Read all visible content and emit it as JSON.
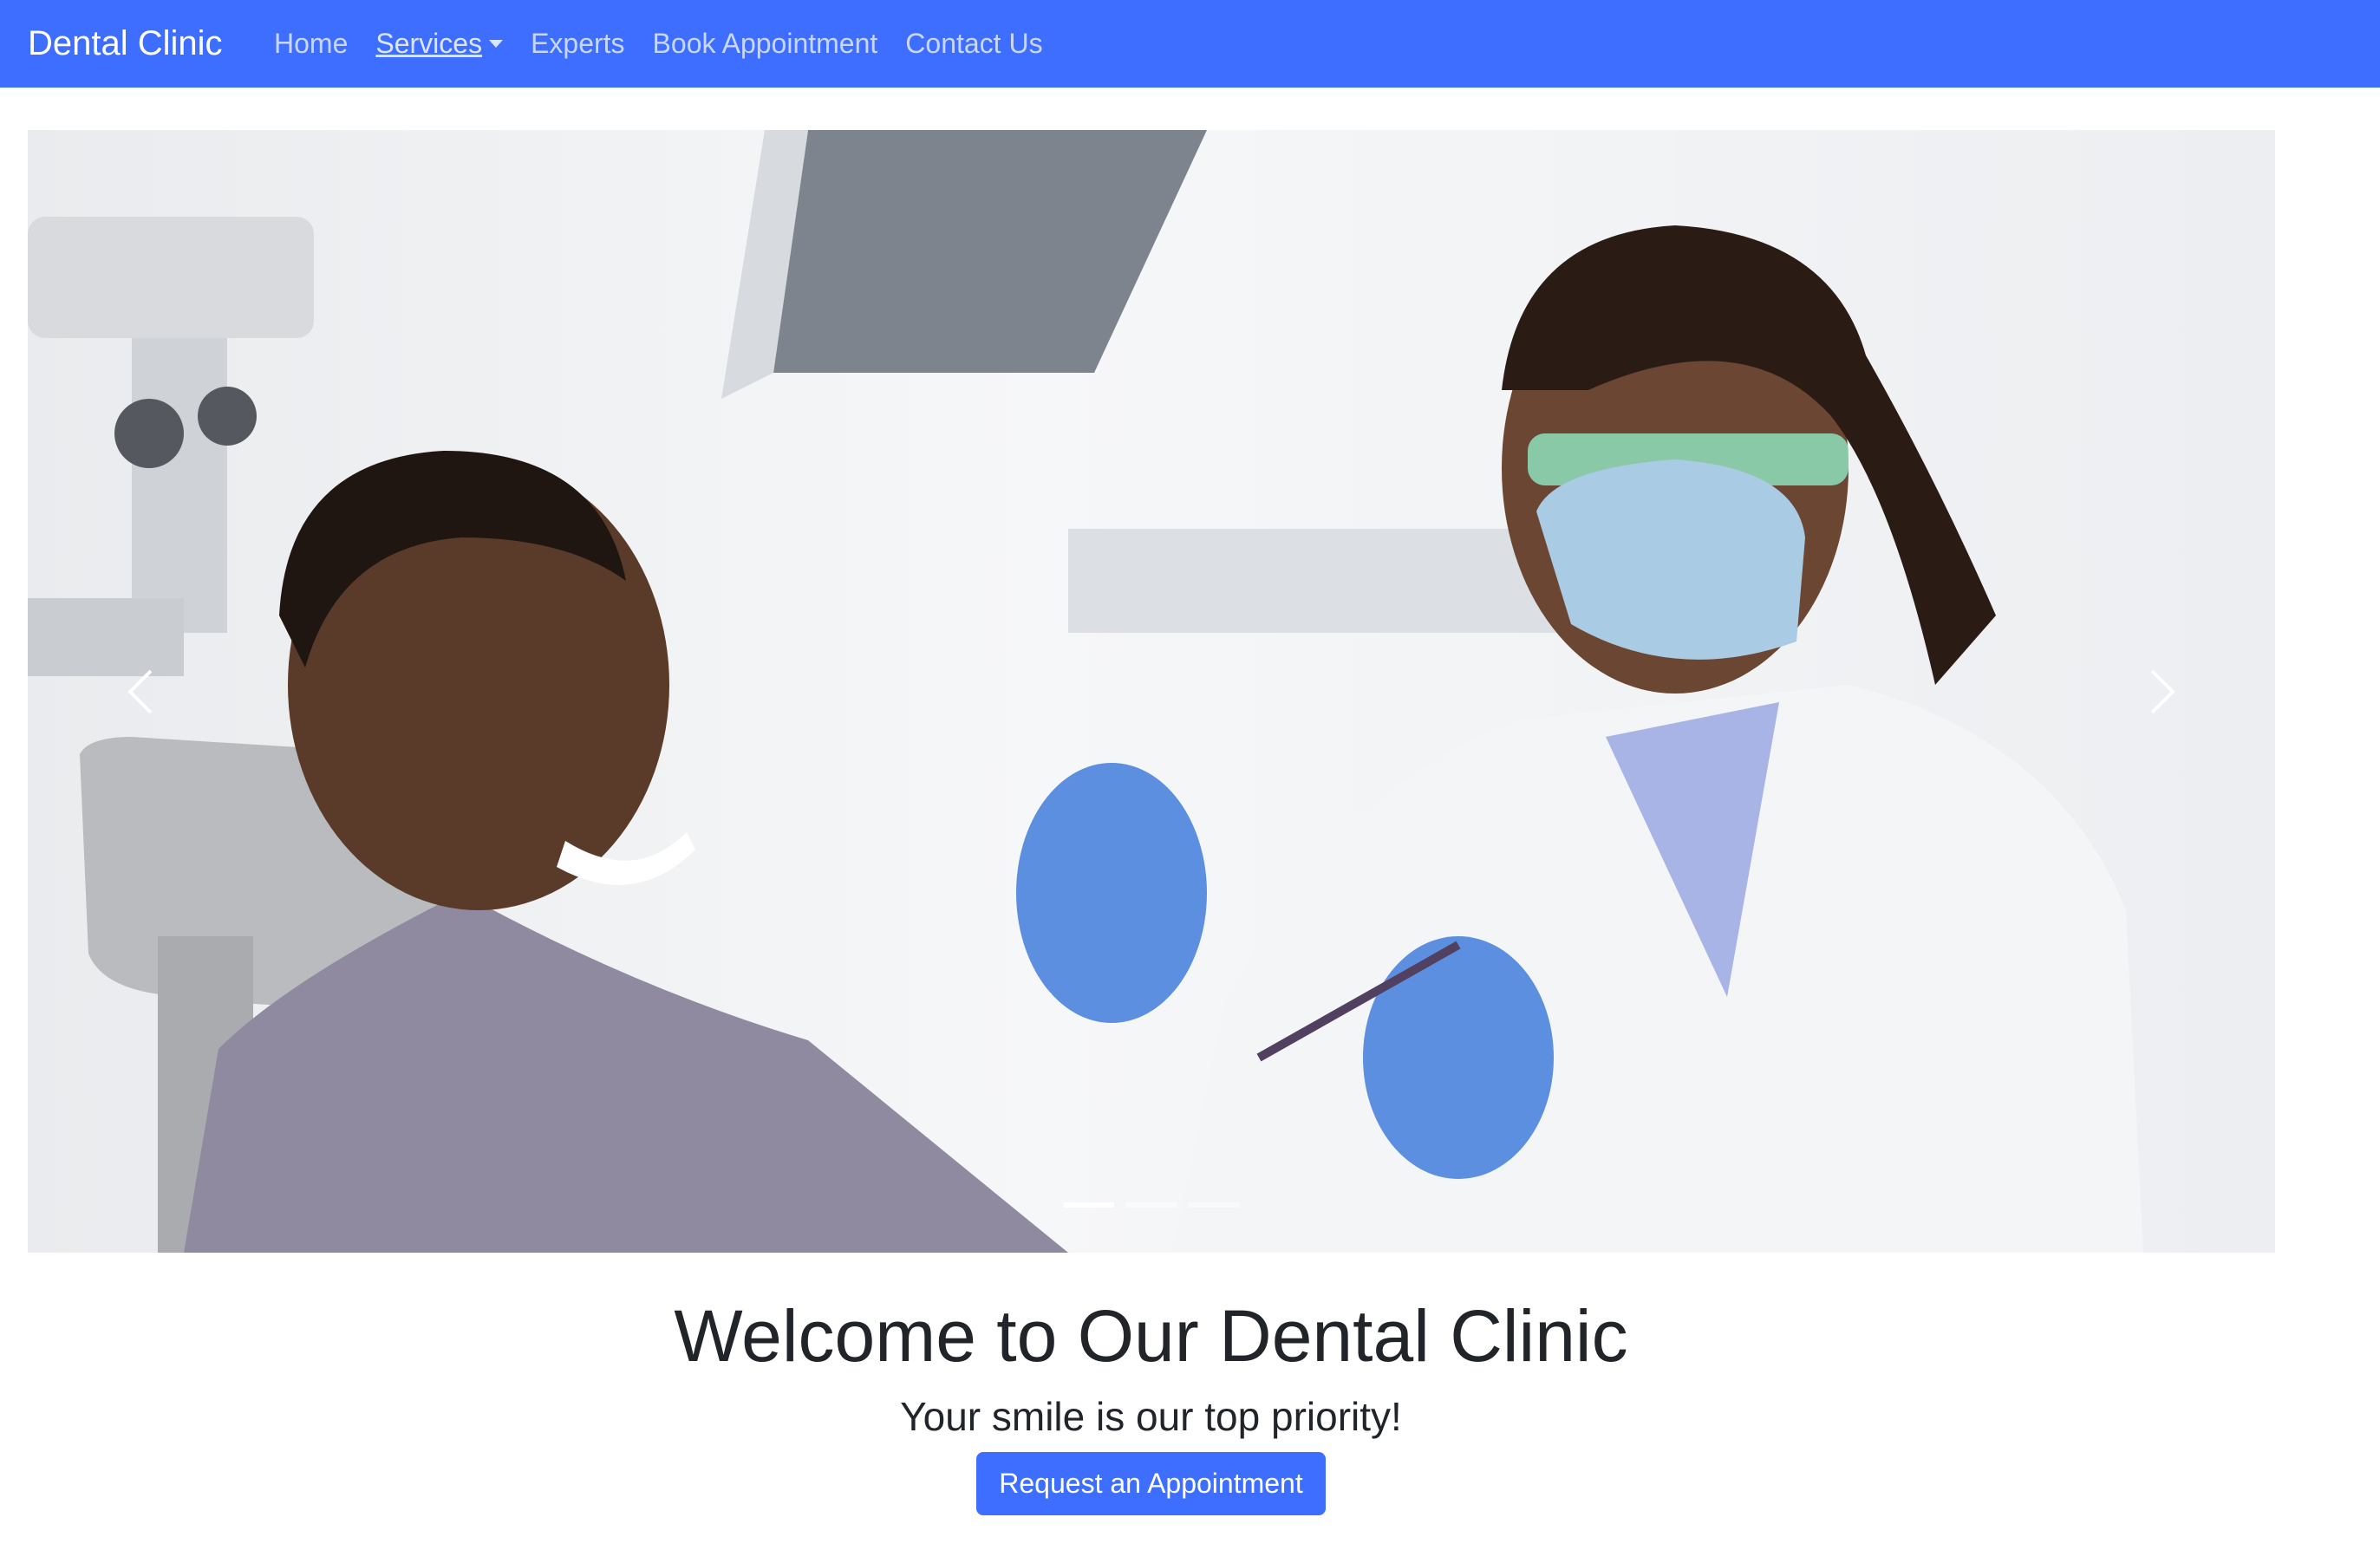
{
  "navbar": {
    "brand": "Dental Clinic",
    "links": [
      {
        "label": "Home"
      },
      {
        "label": "Services",
        "dropdown": true
      },
      {
        "label": "Experts"
      },
      {
        "label": "Book Appointment"
      },
      {
        "label": "Contact Us"
      }
    ],
    "background": "#3d6eff"
  },
  "carousel": {
    "slide_count": 3,
    "active_slide": 1,
    "prev_icon": "chevron-left-icon",
    "next_icon": "chevron-right-icon"
  },
  "hero": {
    "title": "Welcome to Our Dental Clinic",
    "subtitle": "Your smile is our top priority!",
    "cta_label": "Request an Appointment"
  }
}
